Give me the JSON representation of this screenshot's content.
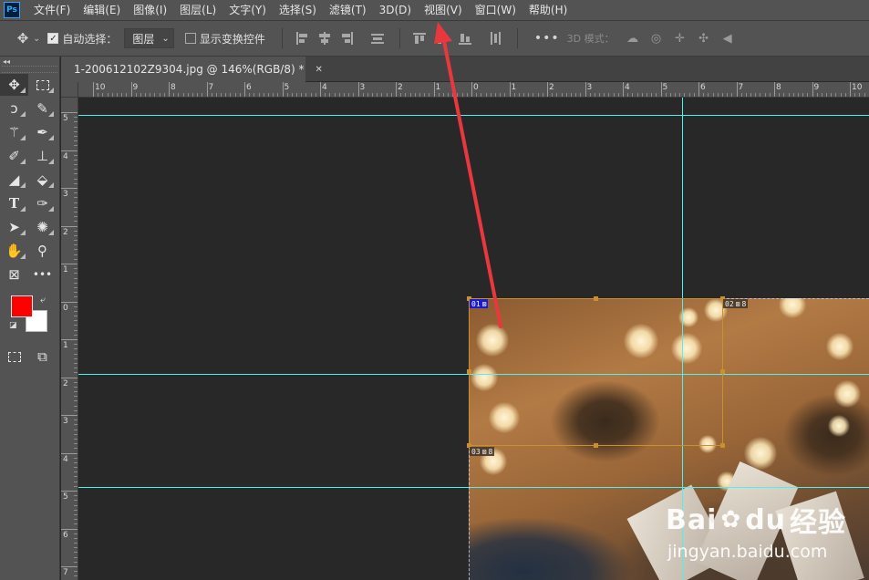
{
  "app": {
    "logo": "Ps"
  },
  "menu": [
    "文件(F)",
    "编辑(E)",
    "图像(I)",
    "图层(L)",
    "文字(Y)",
    "选择(S)",
    "滤镜(T)",
    "3D(D)",
    "视图(V)",
    "窗口(W)",
    "帮助(H)"
  ],
  "options_bar": {
    "auto_select_label": "自动选择：",
    "auto_select_checked": true,
    "layer_dropdown": "图层",
    "show_transform_label": "显示变换控件",
    "show_transform_checked": false,
    "more": "•••",
    "mode_3d_label": "3D 模式："
  },
  "document": {
    "tab_title": "1-200612102Z9304.jpg @ 146%(RGB/8) *",
    "close": "✕"
  },
  "ruler": {
    "top_labels": [
      "10",
      "9",
      "8",
      "7",
      "6",
      "5",
      "4",
      "3",
      "2",
      "1",
      "0",
      "1",
      "2",
      "3",
      "4",
      "5",
      "6",
      "7",
      "8",
      "9",
      "10"
    ],
    "left_labels": [
      "5",
      "4",
      "3",
      "2",
      "1",
      "0",
      "1",
      "2",
      "3",
      "4",
      "5",
      "6",
      "7"
    ]
  },
  "slices": {
    "s01": "01",
    "s02": "02",
    "s03": "03",
    "s02_num": "8",
    "s03_num": "8"
  },
  "colors": {
    "foreground": "#ff0000",
    "background": "#ffffff",
    "guide": "#4ff0f0",
    "slice": "#c8912d",
    "annotation_arrow": "#e8383d"
  },
  "watermark": {
    "brand_a": "Bai",
    "brand_b": "du",
    "brand_cn": "经验",
    "url": "jingyan.baidu.com"
  }
}
